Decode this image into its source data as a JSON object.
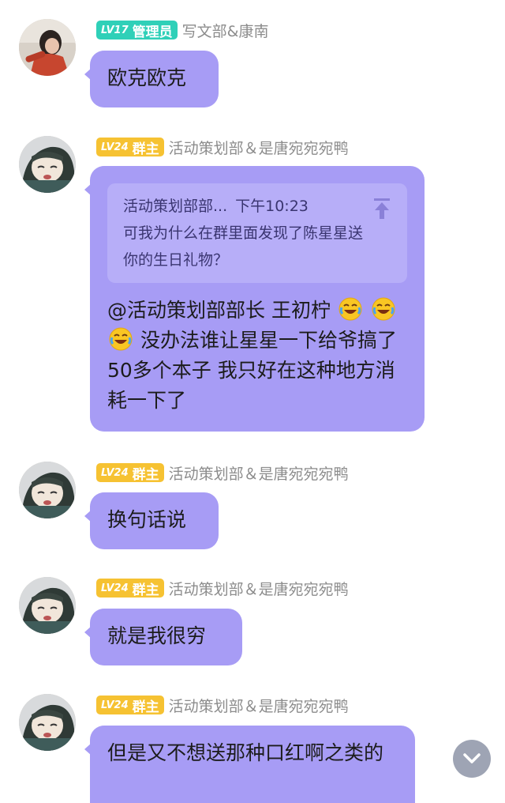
{
  "messages": [
    {
      "badge": {
        "level": "LV17",
        "role": "管理员",
        "type": "admin"
      },
      "sender": "写文部&康南",
      "text": "欧克欧克"
    },
    {
      "badge": {
        "level": "LV24",
        "role": "群主",
        "type": "owner"
      },
      "sender": "活动策划部＆是唐宛宛宛鸭",
      "quote": {
        "author": "活动策划部部...",
        "time": "下午10:23",
        "text": "可我为什么在群里面发现了陈星星送你的生日礼物？",
        "icon": "pin-top-icon"
      },
      "mention": "@活动策划部部长 王初柠",
      "text": "没办法谁让星星一下给爷搞了50多个本子  我只好在这种地方消耗一下了"
    },
    {
      "badge": {
        "level": "LV24",
        "role": "群主",
        "type": "owner"
      },
      "sender": "活动策划部＆是唐宛宛宛鸭",
      "text": "换句话说"
    },
    {
      "badge": {
        "level": "LV24",
        "role": "群主",
        "type": "owner"
      },
      "sender": "活动策划部＆是唐宛宛宛鸭",
      "text": "就是我很穷"
    },
    {
      "badge": {
        "level": "LV24",
        "role": "群主",
        "type": "owner"
      },
      "sender": "活动策划部＆是唐宛宛宛鸭",
      "text": "但是又不想送那种口红啊之类的"
    }
  ],
  "scroll_button": {
    "icon": "chevron-down-icon"
  },
  "colors": {
    "bubble": "#a79cf5",
    "admin_badge": "#2fd0b8",
    "owner_badge": "#f6c232"
  }
}
